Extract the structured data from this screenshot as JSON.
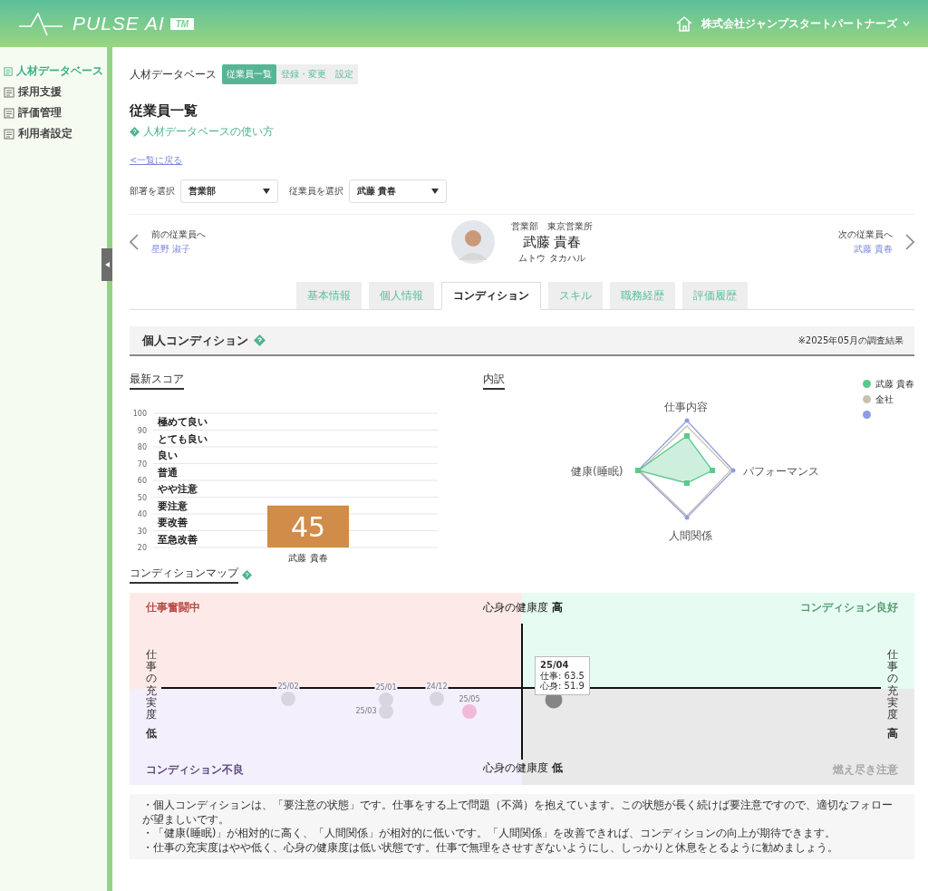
{
  "header": {
    "brand": "PULSE AI",
    "tm": "TM",
    "company": "株式会社ジャンプスタートパートナーズ"
  },
  "sidebar": {
    "items": [
      {
        "label": "人材データベース",
        "selected": true
      },
      {
        "label": "採用支援",
        "selected": false
      },
      {
        "label": "評価管理",
        "selected": false
      },
      {
        "label": "利用者設定",
        "selected": false
      }
    ]
  },
  "breadcrumb": {
    "label": "人材データベース",
    "tabs": [
      {
        "label": "従業員一覧",
        "selected": true
      },
      {
        "label": "登録・変更",
        "selected": false
      },
      {
        "label": "設定",
        "selected": false
      }
    ]
  },
  "page_title": "従業員一覧",
  "help_link": "人材データベースの使い方",
  "back_link": "<一覧に戻る",
  "filters": [
    {
      "label": "部署を選択",
      "value": "営業部"
    },
    {
      "label": "従業員を選択",
      "value": "武藤 貴春"
    }
  ],
  "employee": {
    "prev_label": "前の従業員へ",
    "prev_name": "星野 淑子",
    "dept": "営業部　東京営業所",
    "name": "武藤 貴春",
    "kana": "ムトウ タカハル",
    "next_label": "次の従業員へ",
    "next_name": "武藤 貴春"
  },
  "tabs": [
    {
      "label": "基本情報",
      "selected": false
    },
    {
      "label": "個人情報",
      "selected": false
    },
    {
      "label": "コンディション",
      "selected": true
    },
    {
      "label": "スキル",
      "selected": false
    },
    {
      "label": "職務経歴",
      "selected": false
    },
    {
      "label": "評価履歴",
      "selected": false
    }
  ],
  "section": {
    "title": "個人コンディション",
    "note": "※2025年05月の調査結果"
  },
  "score": {
    "heading": "最新スコア",
    "chart_data": {
      "type": "bar",
      "categories": [
        "武藤 貴春"
      ],
      "values": [
        45
      ],
      "ylim": [
        20,
        100
      ],
      "yticks": [
        20,
        30,
        40,
        50,
        60,
        70,
        80,
        90,
        100
      ],
      "data_labels": true,
      "grid": true,
      "annotations": [
        "極めて良い",
        "とても良い",
        "良い",
        "普通",
        "やや注意",
        "要注意",
        "要改善",
        "至急改善"
      ]
    }
  },
  "breakdown": {
    "heading": "内訳",
    "axes": [
      "仕事内容",
      "パフォーマンス",
      "人間関係",
      "健康(睡眠)"
    ],
    "legend": [
      {
        "label": "武藤 貴春",
        "color": "#5cc98f"
      },
      {
        "label": "全社",
        "color": "#c8c3ad"
      },
      {
        "color": "#8f9de0"
      }
    ]
  },
  "map": {
    "heading": "コンディションマップ",
    "quadrants": [
      {
        "label": "仕事奮闘中",
        "color": "#b84a45"
      },
      {
        "label": "コンディション良好",
        "color": "#5a9a72"
      },
      {
        "label": "コンディション不良",
        "color": "#5a4a7a"
      },
      {
        "label": "燃え尽き注意",
        "color": "#a8a8a8"
      }
    ],
    "top_axis": "心身の健康度",
    "top_level": "高",
    "bottom_axis": "心身の健康度",
    "bottom_level": "低",
    "left_axis": "仕事の充実度",
    "left_level": "低",
    "right_axis": "仕事の充実度",
    "right_level": "高",
    "points": [
      {
        "label": "25/02",
        "color": "#d9d5e0"
      },
      {
        "label": "25/01",
        "color": "#d9d5e0"
      },
      {
        "label": "25/03",
        "color": "#d9d5e0"
      },
      {
        "label": "24/12",
        "color": "#d9d5e0"
      },
      {
        "label": "25/05",
        "color": "#f1b8d9"
      },
      {
        "color": "#858585"
      }
    ],
    "tooltip": {
      "title": "25/04",
      "lines": [
        "仕事: 63.5",
        "心身: 51.9"
      ]
    }
  },
  "comments": [
    "・個人コンディションは、「要注意の状態」です。仕事をする上で問題（不満）を抱えています。この状態が長く続けば要注意ですので、適切なフォローが望ましいです。",
    "・「健康(睡眠)」が相対的に高く、「人間関係」が相対的に低いです。「人間関係」を改善できれば、コンディションの向上が期待できます。",
    "・仕事の充実度はやや低く、心身の健康度は低い状態です。仕事で無理をさせすぎないようにし、しっかりと休息をとるように勧めましょう。"
  ]
}
